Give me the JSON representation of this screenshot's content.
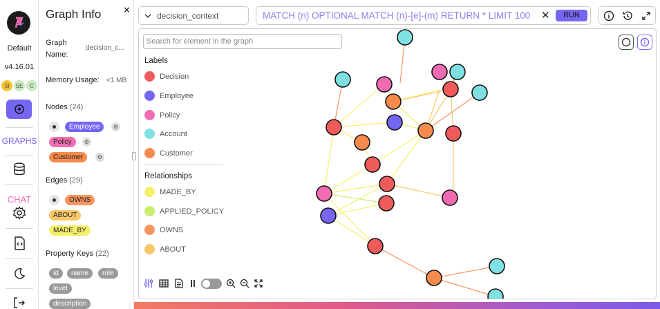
{
  "rail": {
    "logo_letter": "F",
    "instance": "Default",
    "version": "v4.16.01",
    "badges": [
      {
        "label": "SI",
        "color": "#f2c12e"
      },
      {
        "label": "SE",
        "color": "#c9e9c0"
      },
      {
        "label": "C",
        "color": "#c9e9c0"
      }
    ],
    "nav_graphs": "GRAPHS",
    "nav_chat": "CHAT",
    "accent": "#7466f0"
  },
  "panel": {
    "title": "Graph Info",
    "graph_name_label": "Graph Name:",
    "graph_name_value": "decision_c...",
    "memory_label": "Memory Usage:",
    "memory_value": "<1 MB",
    "nodes_label": "Nodes",
    "nodes_count": "(24)",
    "node_labels": [
      {
        "label": "Employee",
        "color": "#7466f0"
      },
      {
        "label": "Policy",
        "color": "#f06fb0"
      },
      {
        "label": "Customer",
        "color": "#f58a4c"
      }
    ],
    "edges_label": "Edges",
    "edges_count": "(29)",
    "edge_labels": [
      {
        "label": "OWNS",
        "color": "#f7955f"
      },
      {
        "label": "ABOUT",
        "color": "#f7c768"
      },
      {
        "label": "MADE_BY",
        "color": "#f6f06a"
      }
    ],
    "props_label": "Property Keys",
    "props_count": "(22)",
    "prop_keys": [
      "id",
      "name",
      "role",
      "level",
      "description"
    ]
  },
  "topbar": {
    "context_value": "decision_context",
    "query": "MATCH (n) OPTIONAL MATCH (n)-[e]-(m) RETURN * LIMIT 100",
    "run_label": "RUN"
  },
  "canvas": {
    "search_placeholder": "Search for element in the graph",
    "labels_title": "Labels",
    "labels": [
      {
        "name": "Decision",
        "color": "#ef5a5a"
      },
      {
        "name": "Employee",
        "color": "#7466f0"
      },
      {
        "name": "Policy",
        "color": "#f26bb2"
      },
      {
        "name": "Account",
        "color": "#7ee0e0"
      },
      {
        "name": "Customer",
        "color": "#f58a4c"
      }
    ],
    "relationships_title": "Relationships",
    "relationships": [
      {
        "name": "MADE_BY",
        "color": "#f6f06a"
      },
      {
        "name": "APPLIED_POLICY",
        "color": "#c8ef6e"
      },
      {
        "name": "OWNS",
        "color": "#f7955f"
      },
      {
        "name": "ABOUT",
        "color": "#f7c768"
      }
    ]
  }
}
